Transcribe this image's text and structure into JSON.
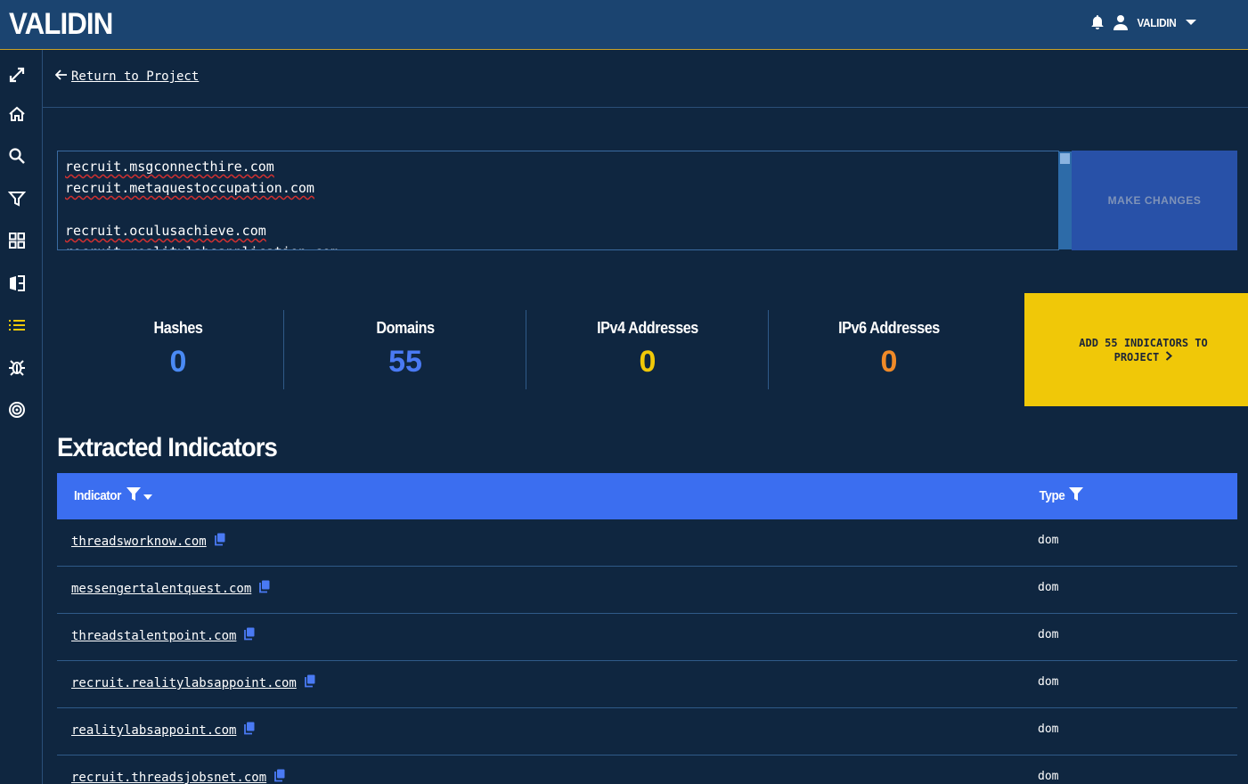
{
  "app": {
    "logo": "VALIDIN",
    "username": "VALIDIN"
  },
  "icons": {
    "bell": "bell-icon",
    "user": "user-icon",
    "dropdown": "caret-down-icon",
    "sidebar": [
      "expand-icon",
      "home-icon",
      "search-icon",
      "filter-icon",
      "grid-icon",
      "compare-icon",
      "list-icon",
      "bug-icon",
      "target-icon"
    ]
  },
  "nav": {
    "return_label": "Return to Project"
  },
  "editor": {
    "lines": [
      "recruit.msgconnecthire.com",
      "recruit.metaquestoccupation.com",
      "",
      "recruit.oculusachieve.com",
      "recruit.realitylabsapplication.com"
    ]
  },
  "buttons": {
    "make_changes": "MAKE CHANGES",
    "add_line1": "ADD 55 INDICATORS TO",
    "add_line2": "PROJECT"
  },
  "stats": [
    {
      "label": "Hashes",
      "value": "0",
      "color": "#4a8af4"
    },
    {
      "label": "Domains",
      "value": "55",
      "color": "#4a7af4"
    },
    {
      "label": "IPv4 Addresses",
      "value": "0",
      "color": "#f0c808"
    },
    {
      "label": "IPv6 Addresses",
      "value": "0",
      "color": "#f08a28"
    }
  ],
  "section": {
    "title": "Extracted Indicators"
  },
  "table": {
    "headers": {
      "indicator": "Indicator",
      "type": "Type"
    },
    "rows": [
      {
        "indicator": "threadsworknow.com",
        "type": "dom"
      },
      {
        "indicator": "messengertalentquest.com",
        "type": "dom"
      },
      {
        "indicator": "threadstalentpoint.com",
        "type": "dom"
      },
      {
        "indicator": "recruit.realitylabsappoint.com",
        "type": "dom"
      },
      {
        "indicator": "realitylabsappoint.com",
        "type": "dom"
      },
      {
        "indicator": "recruit.threadsjobsnet.com",
        "type": "dom"
      }
    ]
  },
  "colors": {
    "topbar": "#1b4470",
    "background": "#0f2640",
    "accent_blue": "#3b6ef0",
    "accent_yellow": "#f0c808",
    "copy_icon": "#4a7af4"
  }
}
